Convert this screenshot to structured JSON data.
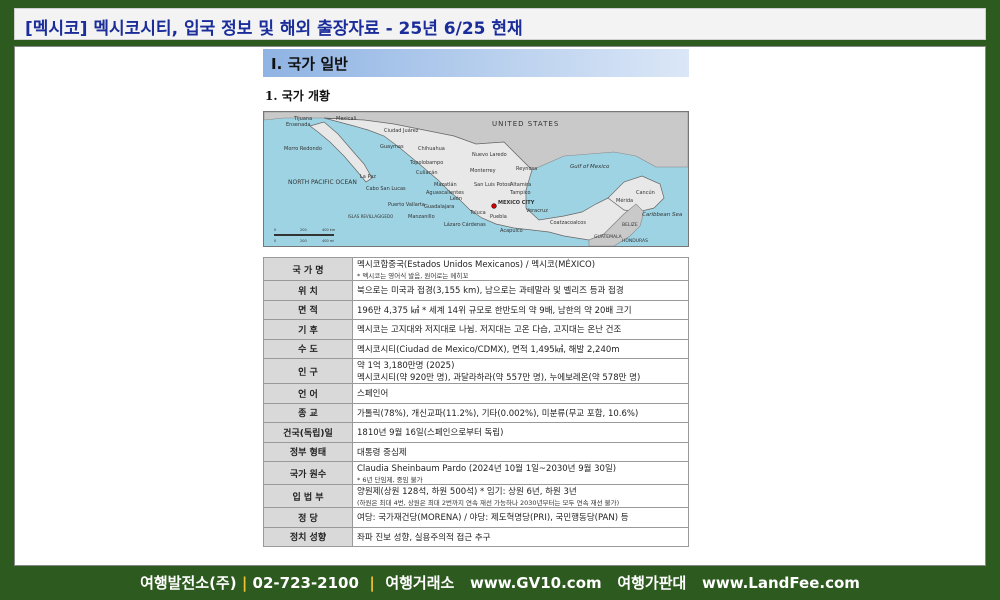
{
  "page_title": "[멕시코] 멕시코시티,  입국  정보 및 해외 출장자료 - 25년 6/25 현재",
  "section_heading": "I. 국가 일반",
  "subsection_heading": "1. 국가 개황",
  "map": {
    "labels": {
      "tijuana": "Tijuana",
      "mexicali": "Mexicali",
      "ensenada": "Ensenada",
      "united_states": "UNITED STATES",
      "ciudad_juarez": "Ciudad Juárez",
      "morro_redondo": "Morro Redondo",
      "guaymas": "Guaymas",
      "chihuahua": "Chihuahua",
      "nuevo_laredo": "Nuevo Laredo",
      "topolobampo": "Topolobampo",
      "culiacan": "Culiacán",
      "la_paz": "La Paz",
      "reynosa": "Reynosa",
      "monterrey": "Monterrey",
      "gulf_of_mexico": "Gulf of Mexico",
      "north_pacific_ocean": "NORTH PACIFIC OCEAN",
      "cabo_san_lucas": "Cabo San Lucas",
      "mazatlan": "Mazatlán",
      "aguascalientes": "Aguascalientes",
      "san_luis_potosi": "San Luis Potosí",
      "altamira": "Altamira",
      "tampico": "Tampico",
      "leon": "León",
      "guadalajara": "Guadalajara",
      "puerto_vallarta": "Puerto Vallarta",
      "mexico_city": "MEXICO CITY",
      "toluca": "Toluca",
      "puebla": "Puebla",
      "veracruz": "Veracruz",
      "manzanillo": "Manzanillo",
      "lazaro_cardenas": "Lázaro Cárdenas",
      "acapulco": "Acapulco",
      "coatzacoalcos": "Coatzacoalcos",
      "cancun": "Cancún",
      "merida": "Mérida",
      "caribbean_sea": "Caribbean Sea",
      "guatemala": "GUATEMALA",
      "belize": "BELIZE",
      "honduras": "HONDURAS",
      "revillagigedo": "ISLAS REVILLAGIGEDO"
    },
    "scale_labels": [
      "0",
      "200",
      "400 km",
      "0",
      "200",
      "400 mi"
    ]
  },
  "info_rows": [
    {
      "key": "국 가 명",
      "value": "멕시코합중국(Estados Unidos Mexicanos) / 멕시코(MÉXICO)",
      "note": "* 멕시코는 영어식 발음, 원어로는 메히꼬"
    },
    {
      "key": "위        치",
      "value": "북으로는 미국과 접경(3,155 km), 남으로는 과테말라 및 벨리즈 등과 접경",
      "note": ""
    },
    {
      "key": "면        적",
      "value": "196만 4,375 ㎢ * 세계 14위 규모로 한반도의 약 9배, 남한의 약 20배 크기",
      "note": ""
    },
    {
      "key": "기        후",
      "value": "멕시코는 고지대와 저지대로 나뉨. 저지대는 고온 다습, 고지대는 온난 건조",
      "note": ""
    },
    {
      "key": "수        도",
      "value": "멕시코시티(Ciudad de Mexico/CDMX), 면적 1,495㎢, 해발 2,240m",
      "note": ""
    },
    {
      "key": "인        구",
      "value": "약 1억 3,180만명 (2025)",
      "value2": "멕시코시티(약 920만 명), 과달라하라(약 557만 명), 누에보레온(약 578만 명)",
      "note": ""
    },
    {
      "key": "언        어",
      "value": "스페인어",
      "note": ""
    },
    {
      "key": "종        교",
      "value": "가톨릭(78%), 개신교파(11.2%), 기타(0.002%), 미분류(무교 포함, 10.6%)",
      "note": ""
    },
    {
      "key": "건국(독립)일",
      "value": "1810년 9월 16일(스페인으로부터 독립)",
      "note": ""
    },
    {
      "key": "정부 형태",
      "value": "대통령 중심제",
      "note": ""
    },
    {
      "key": "국가 원수",
      "value": "Claudia Sheinbaum Pardo (2024년 10월 1일~2030년 9월 30일)",
      "note": "* 6년 단임제, 중임 불가"
    },
    {
      "key": "입  법  부",
      "value": "양원제(상원 128석, 하원 500석) * 임기: 상원 6년, 하원 3년",
      "value2": "(하원은 최대 4번, 상원은 최대 2번까지 연속 재선 가능하나 2030년부터는 모두 연속 재선 불가)",
      "note": ""
    },
    {
      "key": "정        당",
      "value": "여당: 국가재건당(MORENA) / 야당: 제도혁명당(PRI), 국민행동당(PAN) 등",
      "note": ""
    },
    {
      "key": "정치 성향",
      "value": "좌파 진보 성향, 실용주의적 접근 추구",
      "note": ""
    }
  ],
  "footer": {
    "company": "여행발전소(주)",
    "phone": "02-723-2100",
    "agency": "여행거래소",
    "site1": "www.GV10.com",
    "price": "여행가판대",
    "site2": "www.LandFee.com",
    "separator": "|"
  },
  "colors": {
    "background": "#2d5a1e",
    "title_text": "#1a2d9a",
    "separator": "#f1c232",
    "land_mexico": "#e8e8e8",
    "land_us": "#c9c9c9",
    "sea": "#9ed3e3"
  }
}
